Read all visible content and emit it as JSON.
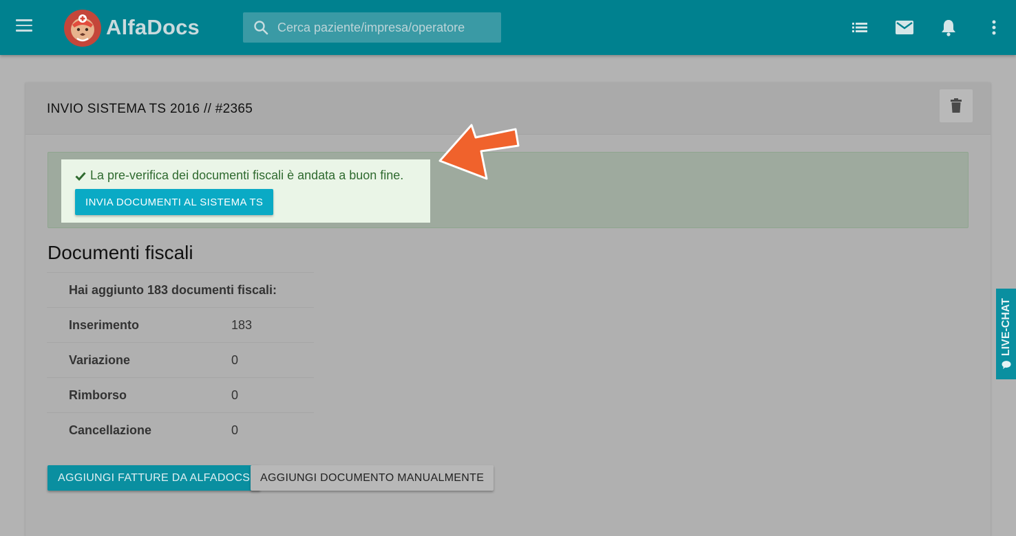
{
  "topbar": {
    "brand": "AlfaDocs",
    "search_placeholder": "Cerca paziente/impresa/operatore",
    "icons": [
      "list-icon",
      "mail-icon",
      "bell-icon",
      "more-vert-icon"
    ]
  },
  "card": {
    "title": "INVIO SISTEMA TS 2016 // #2365",
    "alert": {
      "message": "La pre-verifica dei documenti fiscali è andata a buon fine.",
      "send_button": "INVIA DOCUMENTI AL SISTEMA TS"
    },
    "section_title": "Documenti fiscali",
    "summary": "Hai aggiunto 183 documenti fiscali:",
    "rows": [
      {
        "label": "Inserimento",
        "value": "183"
      },
      {
        "label": "Variazione",
        "value": "0"
      },
      {
        "label": "Rimborso",
        "value": "0"
      },
      {
        "label": "Cancellazione",
        "value": "0"
      }
    ],
    "add_invoices_button": "AGGIUNGI FATTURE DA ALFADOCS",
    "add_manual_button": "AGGIUNGI DOCUMENTO MANUALMENTE"
  },
  "live_chat": "LIVE-CHAT",
  "colors": {
    "topbar": "#00818f",
    "primary_button": "#0aaac5",
    "success_text": "#2f6a2f",
    "annotation_arrow": "#f0622c"
  }
}
